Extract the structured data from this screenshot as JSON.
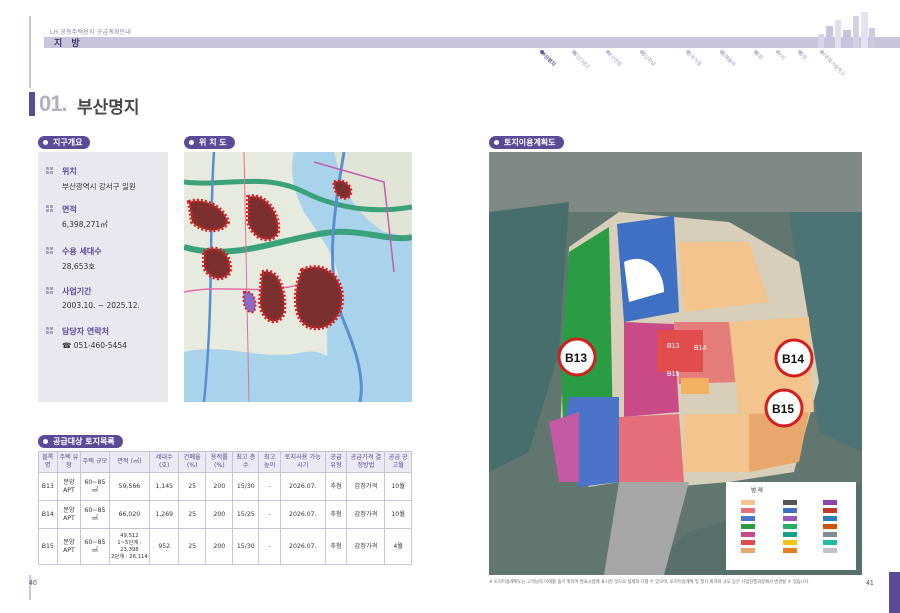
{
  "header": {
    "subtitle": "LH 공동주택용지 공급계획안내",
    "section_title": "지 방",
    "nav": [
      "부산명지",
      "울산다운2",
      "대구연경",
      "경산하양",
      "진주가호",
      "김해율하",
      "포항",
      "구미",
      "창원",
      "나주빛가람혁신"
    ]
  },
  "title": {
    "number": "01.",
    "name": "부산명지"
  },
  "tags": {
    "overview": "지구개요",
    "location": "위 치 도",
    "landuse": "토지이용계획도",
    "supply": "공급대상 토지목록"
  },
  "overview": [
    {
      "label": "위치",
      "value": "부산광역시 강서구 일원"
    },
    {
      "label": "면적",
      "value": "6,398,271㎡"
    },
    {
      "label": "수용 세대수",
      "value": "28,653호"
    },
    {
      "label": "사업기간",
      "value": "2003.10. ~ 2025.12."
    },
    {
      "label": "담당자 연락처",
      "value": "☎ 051-460-5454"
    }
  ],
  "map_labels": {
    "b13": "B13",
    "b14": "B14",
    "b15": "B15",
    "legend_title": "범 례"
  },
  "table": {
    "headers": [
      "블록명",
      "주택 유형",
      "주택 규모",
      "면적 (㎡)",
      "세대수 (호)",
      "건폐율 (%)",
      "용적률 (%)",
      "최고 층수",
      "최고 높이",
      "토지사용 가능시기",
      "공급 유형",
      "공급가격 결정방법",
      "공급 공고월"
    ],
    "rows": [
      [
        "B13",
        "분양APT",
        "60~85㎡",
        "59,566",
        "1,145",
        "25",
        "200",
        "15/30",
        "-",
        "2026.07.",
        "추첨",
        "감정가격",
        "10월"
      ],
      [
        "B14",
        "분양APT",
        "60~85㎡",
        "66,020",
        "1,269",
        "25",
        "200",
        "15/25",
        "-",
        "2026.07.",
        "추첨",
        "감정가격",
        "10월"
      ],
      [
        "B15",
        "분양APT",
        "60~85㎡",
        "49,512\n1~5단계 : 23,398\n2단계 : 26,114",
        "952",
        "25",
        "200",
        "15/30",
        "-",
        "2026.07.",
        "추첨",
        "감정가격",
        "4월"
      ]
    ]
  },
  "footnote": "※ 토지이용계획도는 고객님의 이해를 돕기 위하여 발표시점에 표시된 것으로 실제와 다를 수 있으며, 토지이용계획 및 필지 위치와 규모 등은 사업진행과정에서 변경될 수 있습니다.",
  "pages": {
    "left": "40",
    "right": "41"
  }
}
